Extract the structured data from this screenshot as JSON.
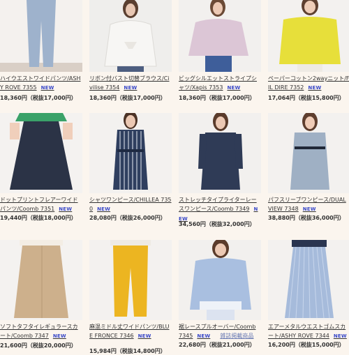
{
  "new_badge": "NEW",
  "products": [
    {
      "name": "ハイウエストワイドパンツ/ASHY ROVE 7355",
      "price": "18,360円（税抜17,000円）",
      "new": true
    },
    {
      "name": "リボン付バスト切替ブラウス/Civilise 7354",
      "price": "18,360円（税抜17,000円）",
      "new": true
    },
    {
      "name": "ビッグシルエットストライプシャツ/Xapis 7353",
      "price": "18,360円（税抜17,000円）",
      "new": true
    },
    {
      "name": "ペーパーコットン2wayニット/FIL DIRE 7352",
      "price": "17,064円（税抜15,800円）",
      "new": true
    },
    {
      "name": "ドットプリントフレアーワイドパンツ/Coomb 7351",
      "price": "19,440円（税抜18,000円）",
      "new": true
    },
    {
      "name": "シャツワンピース/CHILLEA 7350",
      "price": "28,080円（税抜26,000円）",
      "new": true
    },
    {
      "name": "ストレッチタイプライターレースワンピース/Coomb 7349",
      "price": "34,560円（税抜32,000円）",
      "new": true
    },
    {
      "name": "パフスリーブワンピース/DUAL VIEW 7348",
      "price": "38,880円（税抜36,000円）",
      "new": true
    },
    {
      "name": "ソフトタフタイレギュラースカート/Coomb 7347",
      "price": "21,600円（税抜20,000円）",
      "new": true
    },
    {
      "name": "麻混ミドル丈ワイドパンツ/BLUE FRONCE 7346",
      "price": "15,984円（税抜14,800円）",
      "new": true
    },
    {
      "name": "裾レースプルオーバー/Coomb 7345",
      "price": "22,680円（税抜21,000円）",
      "new": true,
      "extra": "雑誌掲載商品"
    },
    {
      "name": "エアーメタルウエストゴムスカート/ASHY ROVE 7344",
      "price": "16,200円（税抜15,000円）",
      "new": true
    }
  ]
}
